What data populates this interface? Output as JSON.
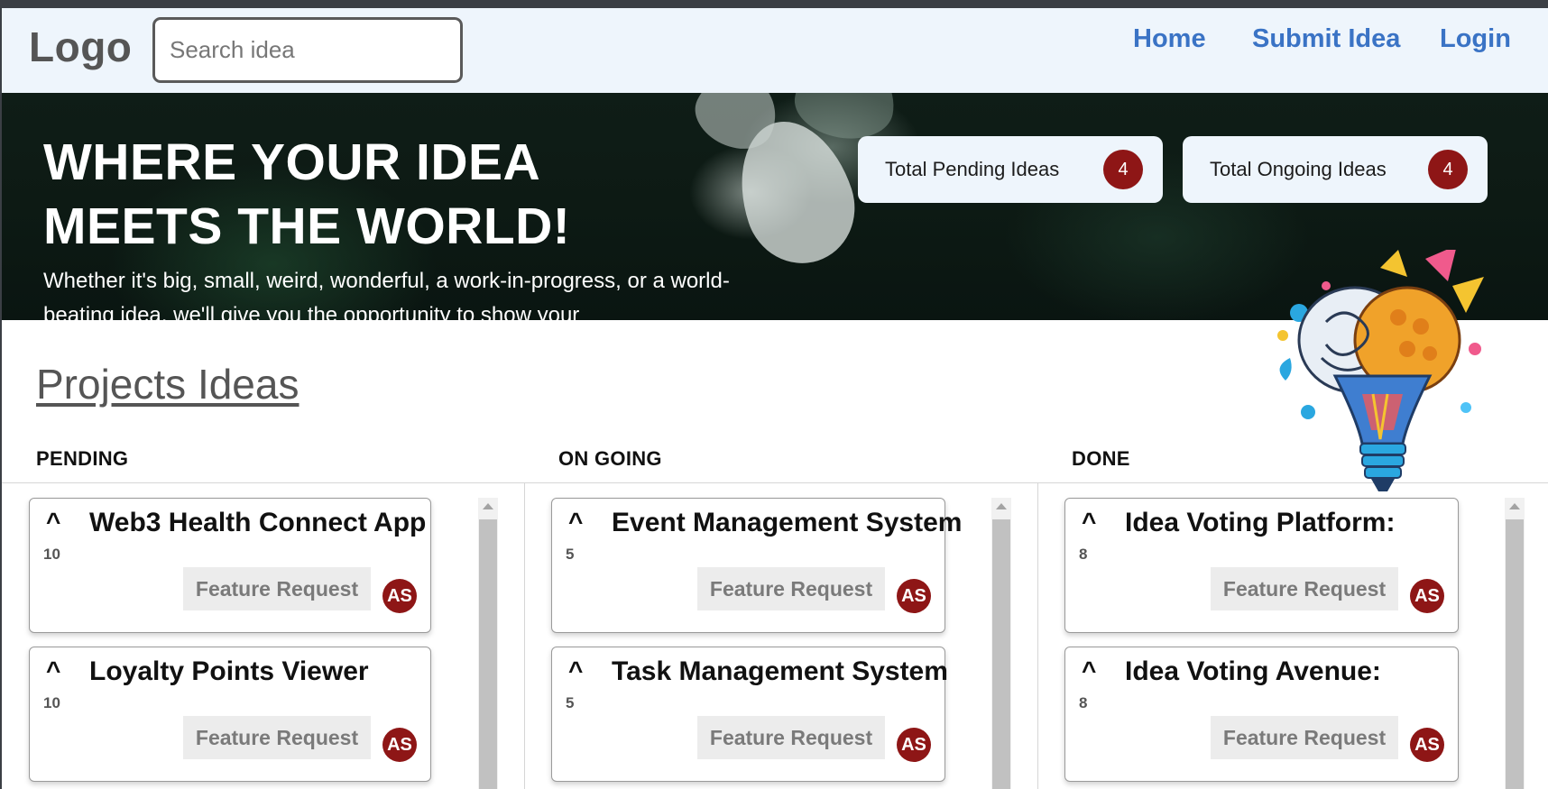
{
  "header": {
    "logo": "Logo",
    "search_placeholder": "Search idea",
    "nav": [
      "Home",
      "Submit Idea",
      "Login"
    ]
  },
  "hero": {
    "title": "WHERE YOUR IDEA MEETS THE WORLD!",
    "subtitle": "Whether it's big, small, weird, wonderful, a work-in-progress, or a world-beating idea, we'll give you the opportunity to show your",
    "stats": [
      {
        "label": "Total Pending Ideas",
        "count": "4"
      },
      {
        "label": "Total Ongoing Ideas",
        "count": "4"
      }
    ]
  },
  "projects": {
    "title": "Projects Ideas",
    "columns": [
      {
        "name": "PENDING",
        "cards": [
          {
            "title": "Web3 Health Connect App",
            "votes": "10",
            "tag": "Feature Request",
            "avatar": "AS"
          },
          {
            "title": "Loyalty Points Viewer",
            "votes": "10",
            "tag": "Feature Request",
            "avatar": "AS"
          }
        ]
      },
      {
        "name": "ON GOING",
        "cards": [
          {
            "title": "Event Management System",
            "votes": "5",
            "tag": "Feature Request",
            "avatar": "AS"
          },
          {
            "title": "Task Management System",
            "votes": "5",
            "tag": "Feature Request",
            "avatar": "AS"
          }
        ]
      },
      {
        "name": "DONE",
        "cards": [
          {
            "title": "Idea Voting Platform:",
            "votes": "8",
            "tag": "Feature Request",
            "avatar": "AS"
          },
          {
            "title": "Idea Voting Avenue:",
            "votes": "8",
            "tag": "Feature Request",
            "avatar": "AS"
          }
        ]
      }
    ]
  },
  "icons": {
    "upvote": "^",
    "bulb": "brain-lightbulb-illustration"
  },
  "colors": {
    "nav_link": "#3a73c5",
    "badge": "#8e1616",
    "header_bg": "#eef5fc"
  }
}
